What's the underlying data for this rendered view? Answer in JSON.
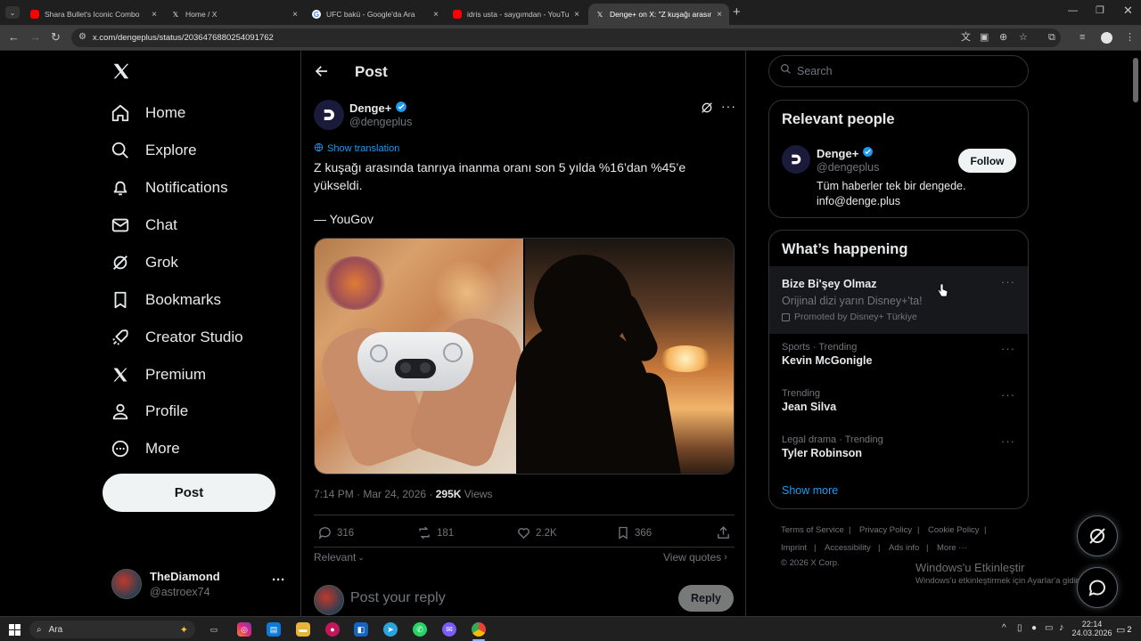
{
  "browser": {
    "tabs": [
      {
        "title": "Shara Bullet's Iconic Combo",
        "close": "×"
      },
      {
        "title": "Home / X",
        "close": "×"
      },
      {
        "title": "UFC bakü - Google'da Ara",
        "close": "×"
      },
      {
        "title": "idris usta - saygımdan - YouTube",
        "close": "×"
      },
      {
        "title": "Denge+ on X: \"Z kuşağı arasında",
        "close": "×"
      }
    ],
    "new_tab": "+",
    "url": "x.com/dengeplus/status/2036476880254091762"
  },
  "nav": {
    "logo": "X",
    "items": [
      {
        "label": "Home",
        "icon": "home-icon"
      },
      {
        "label": "Explore",
        "icon": "search-icon"
      },
      {
        "label": "Notifications",
        "icon": "bell-icon"
      },
      {
        "label": "Chat",
        "icon": "envelope-icon"
      },
      {
        "label": "Grok",
        "icon": "grok-icon"
      },
      {
        "label": "Bookmarks",
        "icon": "bookmark-icon"
      },
      {
        "label": "Creator Studio",
        "icon": "rocket-icon"
      },
      {
        "label": "Premium",
        "icon": "x-logo-icon"
      },
      {
        "label": "Profile",
        "icon": "person-icon"
      },
      {
        "label": "More",
        "icon": "more-circle-icon"
      }
    ],
    "post_button": "Post",
    "account": {
      "name": "TheDiamond",
      "handle": "@astroex74",
      "more": "···"
    }
  },
  "post": {
    "header": "Post",
    "author_name": "Denge+",
    "author_handle": "@dengeplus",
    "show_translation": "Show translation",
    "text_line1": "Z kuşağı arasında tanrıya inanma oranı son 5 yılda %16’dan %45’e",
    "text_line2": "yükseldi.",
    "source": "— YouGov",
    "timestamp": "7:14 PM · Mar 24, 2026 · ",
    "views_count": "295K",
    "views_label": " Views",
    "replies": "316",
    "reposts": "181",
    "likes": "2.2K",
    "bookmarks": "366",
    "sort_label": "Relevant",
    "view_quotes": "View quotes",
    "reply_placeholder": "Post your reply",
    "reply_button": "Reply"
  },
  "sidebar": {
    "search_placeholder": "Search",
    "relevant_title": "Relevant people",
    "person": {
      "name": "Denge+",
      "handle": "@dengeplus",
      "bio_line1": "Tüm haberler tek bir dengede.",
      "bio_line2": "info@denge.plus",
      "follow": "Follow"
    },
    "happening_title": "What’s happening",
    "promo": {
      "title": "Bize Bi'şey Olmaz",
      "subtitle": "Orijinal dizi yarın Disney+'ta!",
      "promoted": "Promoted by Disney+ Türkiye"
    },
    "trends": [
      {
        "context": "Sports · Trending",
        "name": "Kevin McGonigle"
      },
      {
        "context": "Trending",
        "name": "Jean Silva"
      },
      {
        "context": "Legal drama · Trending",
        "name": "Tyler Robinson"
      }
    ],
    "show_more": "Show more",
    "footer": {
      "terms": "Terms of Service",
      "privacy": "Privacy Policy",
      "cookie": "Cookie Policy",
      "imprint": "Imprint",
      "accessibility": "Accessibility",
      "ads": "Ads info",
      "more": "More ···",
      "copyright": "© 2026 X Corp."
    }
  },
  "watermark": {
    "line1": "Windows'u Etkinleştir",
    "line2": "Windows'u etkinleştirmek için Ayarlar'a gidin."
  },
  "taskbar": {
    "search": "Ara",
    "time": "22:14",
    "date": "24.03.2026",
    "notif_count": "2"
  },
  "colors": {
    "accent": "#1d9bf0",
    "background": "#000000",
    "border": "#2f3336",
    "muted": "#71767b"
  }
}
